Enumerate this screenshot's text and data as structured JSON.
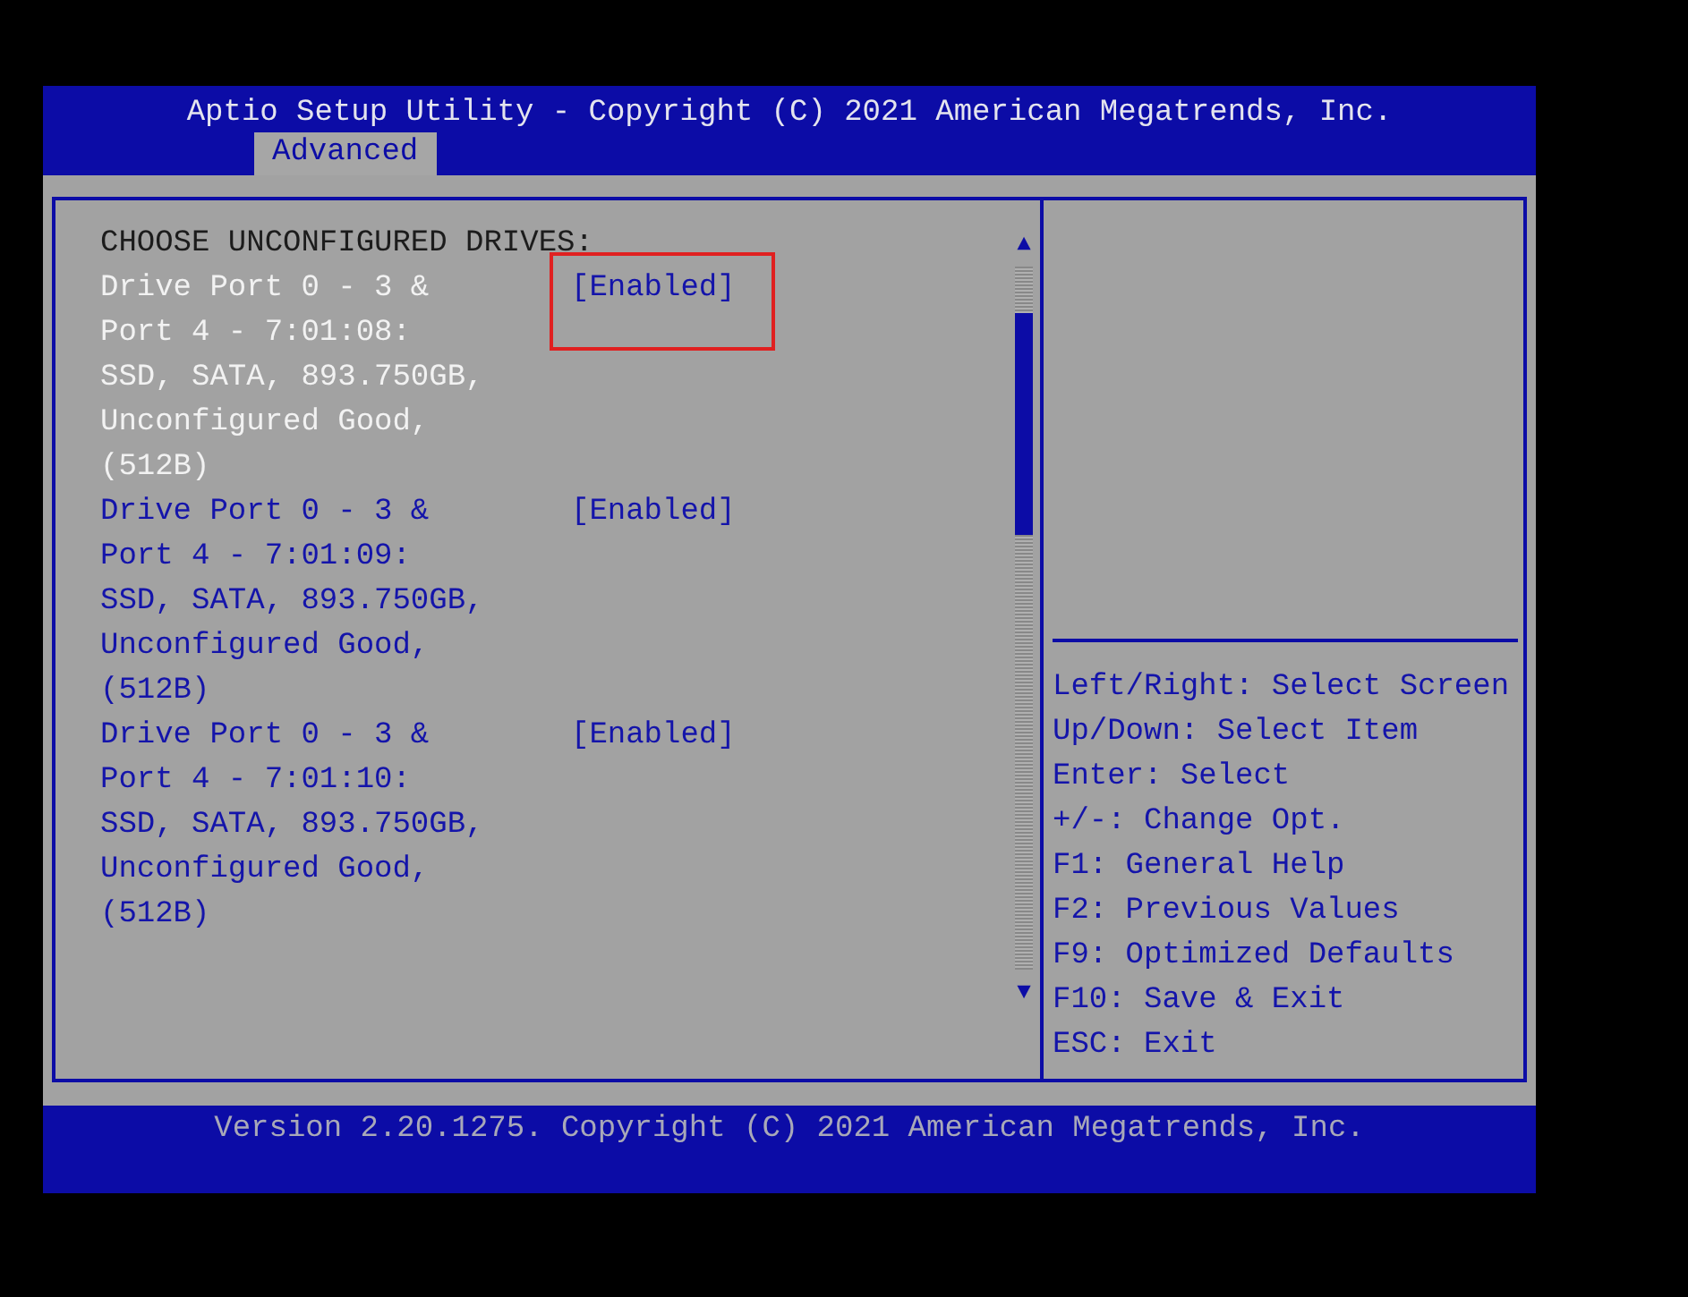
{
  "window": {
    "title": "Aptio Setup Utility - Copyright (C) 2021 American Megatrends, Inc."
  },
  "tabs": [
    {
      "label": "Advanced",
      "selected": true
    }
  ],
  "settings": {
    "heading": "CHOOSE UNCONFIGURED DRIVES:",
    "items": [
      {
        "label": "Drive Port 0 - 3 & Port 4 - 7:01:08: SSD, SATA, 893.750GB, Unconfigured Good, (512B)",
        "value": "[Enabled]",
        "selected": true,
        "highlighted": true
      },
      {
        "label": "Drive Port 0 - 3 & Port 4 - 7:01:09: SSD, SATA, 893.750GB, Unconfigured Good, (512B)",
        "value": "[Enabled]",
        "selected": false,
        "highlighted": false
      },
      {
        "label": "Drive Port 0 - 3 & Port 4 - 7:01:10: SSD, SATA, 893.750GB, Unconfigured Good, (512B)",
        "value": "[Enabled]",
        "selected": false,
        "highlighted": false
      }
    ]
  },
  "scrollbar": {
    "up": "▲",
    "down": "▼"
  },
  "help": [
    "Left/Right: Select Screen",
    "Up/Down: Select Item",
    "Enter: Select",
    "+/-: Change Opt.",
    "F1: General Help",
    "F2: Previous Values",
    "F9: Optimized Defaults",
    "F10: Save & Exit",
    "ESC: Exit"
  ],
  "footer": "Version 2.20.1275. Copyright (C) 2021 American Megatrends, Inc."
}
